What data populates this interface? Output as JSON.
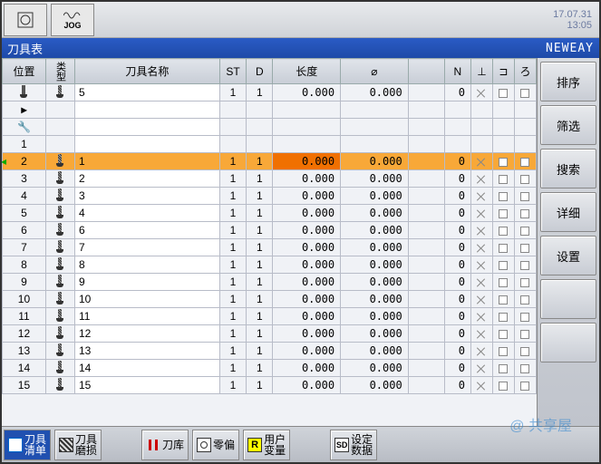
{
  "header": {
    "date": "17.07.31",
    "time": "13:05",
    "jog_label": "JOG"
  },
  "title": {
    "text": "刀具表",
    "brand": "NEWEAY"
  },
  "columns": {
    "pos": "位置",
    "type": "类型",
    "name": "刀具名称",
    "st": "ST",
    "d": "D",
    "length": "长度",
    "diameter": "⌀",
    "n": "N",
    "i1": "⊥",
    "i2": "⊐",
    "i3": "ろ"
  },
  "special_rows": [
    {
      "pos_icon": "clamp",
      "type_icon": "hatch",
      "name": "5",
      "st": "1",
      "d": "1",
      "len": "0.000",
      "dia": "0.000",
      "n": "0"
    },
    {
      "pos_icon": "arrow-right"
    },
    {
      "pos_icon": "wrench"
    },
    {
      "pos": "1"
    }
  ],
  "selected_row": {
    "pos": "2",
    "type_icon": "hatch",
    "name": "1",
    "st": "1",
    "d": "1",
    "len": "0.000",
    "dia": "0.000",
    "n": "0"
  },
  "rows": [
    {
      "pos": "3",
      "name": "2"
    },
    {
      "pos": "4",
      "name": "3"
    },
    {
      "pos": "5",
      "name": "4"
    },
    {
      "pos": "6",
      "name": "6"
    },
    {
      "pos": "7",
      "name": "7"
    },
    {
      "pos": "8",
      "name": "8"
    },
    {
      "pos": "9",
      "name": "9"
    },
    {
      "pos": "10",
      "name": "10"
    },
    {
      "pos": "11",
      "name": "11"
    },
    {
      "pos": "12",
      "name": "12"
    },
    {
      "pos": "13",
      "name": "13"
    },
    {
      "pos": "14",
      "name": "14"
    },
    {
      "pos": "15",
      "name": "15"
    }
  ],
  "row_defaults": {
    "st": "1",
    "d": "1",
    "len": "0.000",
    "dia": "0.000",
    "n": "0"
  },
  "side_buttons": [
    "排序",
    "筛选",
    "搜索",
    "详细",
    "设置",
    "",
    ""
  ],
  "bottom_buttons": [
    {
      "label": "刀具\n清单",
      "active": true,
      "icon": "list"
    },
    {
      "label": "刀具\n磨损",
      "icon": "hatch"
    },
    {
      "label": "",
      "spacer": true
    },
    {
      "label": "刀库",
      "icon": "magazine"
    },
    {
      "label": "零偏",
      "icon": "target"
    },
    {
      "label": "用户\n变量",
      "icon": "R"
    },
    {
      "label": "",
      "spacer": true
    },
    {
      "label": "设定\n数据",
      "icon": "SD"
    }
  ],
  "watermark": "@ 共享屋"
}
